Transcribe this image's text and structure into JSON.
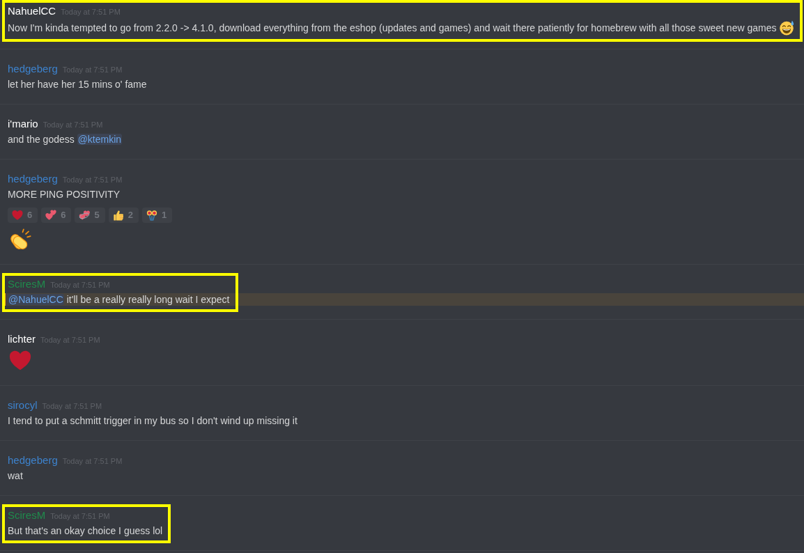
{
  "messages": [
    {
      "author": "NahuelCC",
      "color": "#ffffff",
      "timestamp": "Today at 7:51 PM",
      "boxed": true,
      "mentions_you": false,
      "blocks": [
        {
          "kind": "text",
          "segments": [
            {
              "kind": "text",
              "text": "Now I'm kinda tempted to go from 2.2.0 -> 4.1.0, download everything from the eshop (updates and games) and wait there patiently for homebrew with all those sweet new games"
            },
            {
              "kind": "emoji"
            }
          ]
        }
      ]
    },
    {
      "author": "hedgeberg",
      "color": "#3d82cc",
      "timestamp": "Today at 7:51 PM",
      "boxed": false,
      "mentions_you": false,
      "blocks": [
        {
          "kind": "text",
          "segments": [
            {
              "kind": "text",
              "text": "let her have her 15 mins o' fame"
            }
          ]
        }
      ]
    },
    {
      "author": "i'mario",
      "color": "#ffffff",
      "timestamp": "Today at 7:51 PM",
      "boxed": false,
      "mentions_you": false,
      "blocks": [
        {
          "kind": "text",
          "segments": [
            {
              "kind": "text",
              "text": "and the godess"
            },
            {
              "kind": "mention",
              "text": "@ktemkin"
            }
          ]
        }
      ]
    },
    {
      "author": "hedgeberg",
      "color": "#3d82cc",
      "timestamp": "Today at 7:51 PM",
      "boxed": false,
      "mentions_you": false,
      "blocks": [
        {
          "kind": "text",
          "segments": [
            {
              "kind": "text",
              "text": "MORE PING POSITIVITY"
            }
          ]
        },
        {
          "kind": "reactions",
          "items": [
            {
              "count": "6"
            },
            {
              "count": "6"
            },
            {
              "count": "5"
            },
            {
              "count": "2"
            },
            {
              "count": "1"
            }
          ]
        },
        {
          "kind": "jumbo_emoji"
        }
      ]
    },
    {
      "author": "SciresM",
      "color": "#1f8b4c",
      "timestamp": "Today at 7:51 PM",
      "boxed": true,
      "mentions_you": true,
      "blocks": [
        {
          "kind": "text",
          "segments": [
            {
              "kind": "mention",
              "text": "@NahuelCC"
            },
            {
              "kind": "text",
              "text": "it'll be a really really long wait I expect"
            }
          ]
        }
      ]
    },
    {
      "author": "lichter",
      "color": "#ffffff",
      "timestamp": "Today at 7:51 PM",
      "boxed": false,
      "mentions_you": false,
      "blocks": [
        {
          "kind": "jumbo_emoji"
        }
      ]
    },
    {
      "author": "sirocyl",
      "color": "#3d82cc",
      "timestamp": "Today at 7:51 PM",
      "boxed": false,
      "mentions_you": false,
      "blocks": [
        {
          "kind": "text",
          "segments": [
            {
              "kind": "text",
              "text": "I tend to put a schmitt trigger in my bus so I don't wind up missing it"
            }
          ]
        }
      ]
    },
    {
      "author": "hedgeberg",
      "color": "#3d82cc",
      "timestamp": "Today at 7:51 PM",
      "boxed": false,
      "mentions_you": false,
      "blocks": [
        {
          "kind": "text",
          "segments": [
            {
              "kind": "text",
              "text": "wat"
            }
          ]
        }
      ]
    },
    {
      "author": "SciresM",
      "color": "#1f8b4c",
      "timestamp": "Today at 7:51 PM",
      "boxed": true,
      "mentions_you": false,
      "blocks": [
        {
          "kind": "text",
          "segments": [
            {
              "kind": "text",
              "text": "But that's an okay choice I guess lol"
            }
          ]
        }
      ]
    }
  ]
}
